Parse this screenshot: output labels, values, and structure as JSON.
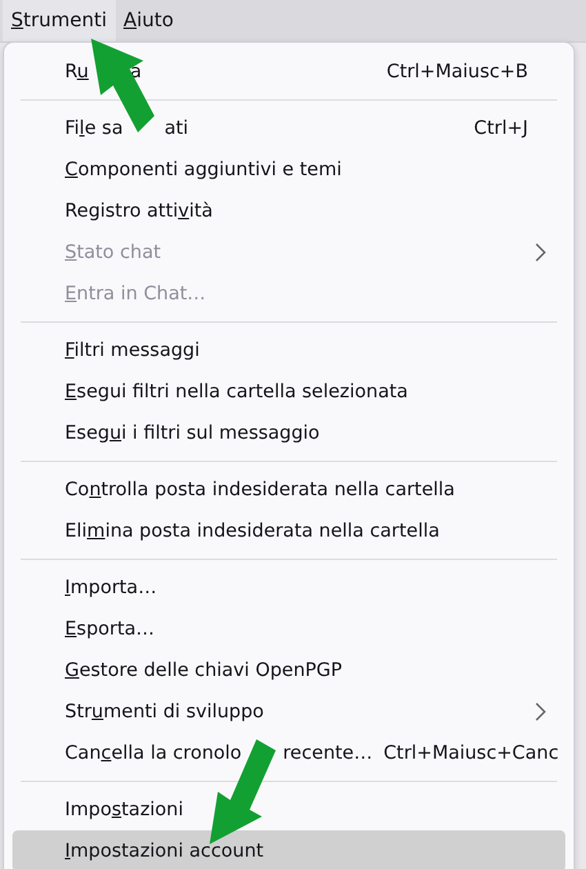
{
  "menubar": [
    {
      "key": "S",
      "after": "trumenti",
      "selected": true
    },
    {
      "key": "A",
      "after": "iuto",
      "selected": false
    }
  ],
  "menu": {
    "sections": [
      {
        "items": [
          {
            "before": "R",
            "key": "u",
            "tail": "a",
            "shortcut": "Ctrl+Maiusc+B",
            "disabled": false,
            "submenu": false,
            "selected": false
          }
        ]
      },
      {
        "items": [
          {
            "before": "Fi",
            "key": "l",
            "after": "e sa",
            "tail": "ati",
            "shortcut": "Ctrl+J",
            "disabled": false,
            "submenu": false,
            "selected": false
          },
          {
            "key": "C",
            "after": "omponenti aggiuntivi e temi",
            "disabled": false,
            "submenu": false,
            "selected": false
          },
          {
            "before": "Registro atti",
            "key": "v",
            "after": "ità",
            "disabled": false,
            "submenu": false,
            "selected": false
          },
          {
            "key": "S",
            "after": "tato chat",
            "disabled": true,
            "submenu": true,
            "selected": false
          },
          {
            "key": "E",
            "after": "ntra in Chat…",
            "disabled": true,
            "submenu": false,
            "selected": false
          }
        ]
      },
      {
        "items": [
          {
            "key": "F",
            "after": "iltri messaggi",
            "disabled": false,
            "submenu": false,
            "selected": false
          },
          {
            "key": "E",
            "after": "segui filtri nella cartella selezionata",
            "disabled": false,
            "submenu": false,
            "selected": false
          },
          {
            "before": "Eseg",
            "key": "u",
            "after": "i i filtri sul messaggio",
            "disabled": false,
            "submenu": false,
            "selected": false
          }
        ]
      },
      {
        "items": [
          {
            "before": "Co",
            "key": "n",
            "after": "trolla posta indesiderata nella cartella",
            "disabled": false,
            "submenu": false,
            "selected": false
          },
          {
            "before": "Eli",
            "key": "m",
            "after": "ina posta indesiderata nella cartella",
            "disabled": false,
            "submenu": false,
            "selected": false
          }
        ]
      },
      {
        "items": [
          {
            "key": "I",
            "after": "mporta…",
            "disabled": false,
            "submenu": false,
            "selected": false
          },
          {
            "key": "E",
            "after": "sporta…",
            "disabled": false,
            "submenu": false,
            "selected": false
          },
          {
            "key": "G",
            "after": "estore delle chiavi OpenPGP",
            "disabled": false,
            "submenu": false,
            "selected": false
          },
          {
            "before": "Str",
            "key": "u",
            "after": "menti di sviluppo",
            "disabled": false,
            "submenu": true,
            "selected": false
          },
          {
            "before": "Can",
            "key": "c",
            "after": "ella la cronolo",
            "tail": "recente…",
            "shortcut": "Ctrl+Maiusc+Canc",
            "disabled": false,
            "submenu": false,
            "selected": false
          }
        ]
      },
      {
        "items": [
          {
            "before": "Impo",
            "key": "s",
            "after": "tazioni",
            "disabled": false,
            "submenu": false,
            "selected": false
          },
          {
            "key": "I",
            "after": "mpostazioni account",
            "disabled": false,
            "submenu": false,
            "selected": true
          }
        ]
      }
    ]
  }
}
